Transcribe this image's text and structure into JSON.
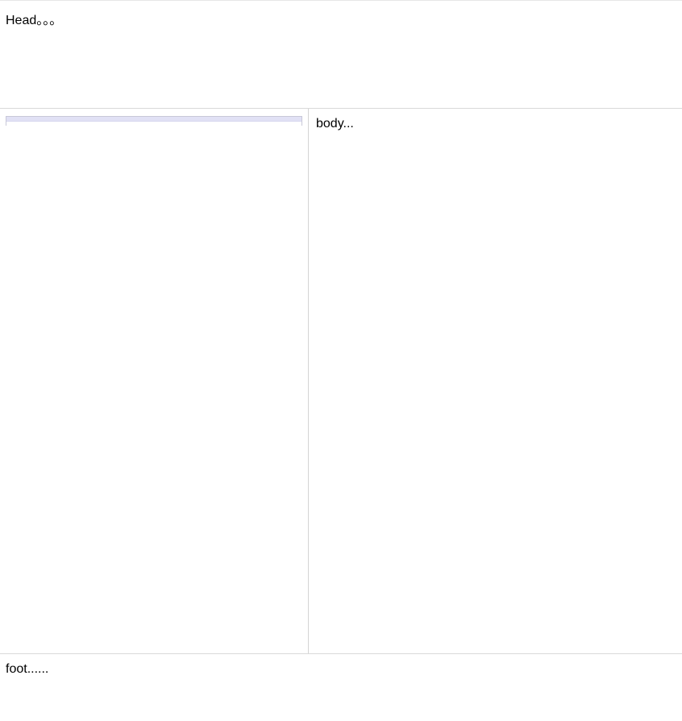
{
  "north": {
    "text": "Head。。。"
  },
  "center": {
    "text": "body..."
  },
  "south": {
    "text": "foot......"
  }
}
